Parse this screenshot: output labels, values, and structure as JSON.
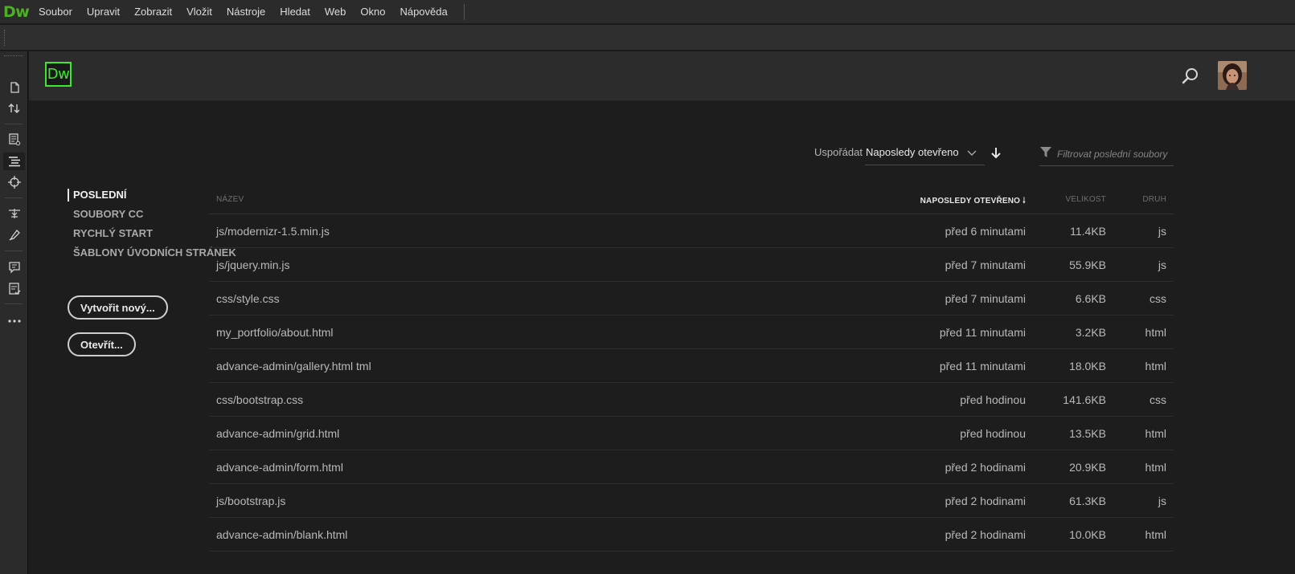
{
  "app": {
    "logo_text": "Dw"
  },
  "menu": [
    "Soubor",
    "Upravit",
    "Zobrazit",
    "Vložit",
    "Nástroje",
    "Hledat",
    "Web",
    "Okno",
    "Nápověda"
  ],
  "header": {
    "badge_text": "Dw"
  },
  "sort": {
    "label": "Uspořádat",
    "selected": "Naposledy otevřeno",
    "filter_placeholder": "Filtrovat poslední soubory"
  },
  "nav": {
    "items": [
      "POSLEDNÍ",
      "SOUBORY CC",
      "RYCHLÝ START",
      "ŠABLONY ÚVODNÍCH STRÁNEK"
    ],
    "active": "POSLEDNÍ",
    "create_button": "Vytvořit nový...",
    "open_button": "Otevřít..."
  },
  "table": {
    "headers": {
      "name": "NÁZEV",
      "opened": "NAPOSLEDY OTEVŘENO",
      "size": "VELIKOST",
      "type": "DRUH"
    },
    "rows": [
      {
        "name": "js/modernizr-1.5.min.js",
        "opened": "před 6 minutami",
        "size": "11.4KB",
        "type": "js"
      },
      {
        "name": "js/jquery.min.js",
        "opened": "před 7 minutami",
        "size": "55.9KB",
        "type": "js"
      },
      {
        "name": "css/style.css",
        "opened": "před 7 minutami",
        "size": "6.6KB",
        "type": "css"
      },
      {
        "name": "my_portfolio/about.html",
        "opened": "před 11 minutami",
        "size": "3.2KB",
        "type": "html"
      },
      {
        "name": "advance-admin/gallery.html tml",
        "opened": "před 11 minutami",
        "size": "18.0KB",
        "type": "html"
      },
      {
        "name": "css/bootstrap.css",
        "opened": "před hodinou",
        "size": "141.6KB",
        "type": "css"
      },
      {
        "name": "advance-admin/grid.html",
        "opened": "před hodinou",
        "size": "13.5KB",
        "type": "html"
      },
      {
        "name": "advance-admin/form.html",
        "opened": "před 2 hodinami",
        "size": "20.9KB",
        "type": "html"
      },
      {
        "name": "js/bootstrap.js",
        "opened": "před 2 hodinami",
        "size": "61.3KB",
        "type": "js"
      },
      {
        "name": "advance-admin/blank.html",
        "opened": "před 2 hodinami",
        "size": "10.0KB",
        "type": "html"
      }
    ]
  },
  "colors": {
    "accent": "#3ee82e",
    "logo": "#4caf24",
    "background": "#1d1d1d"
  }
}
